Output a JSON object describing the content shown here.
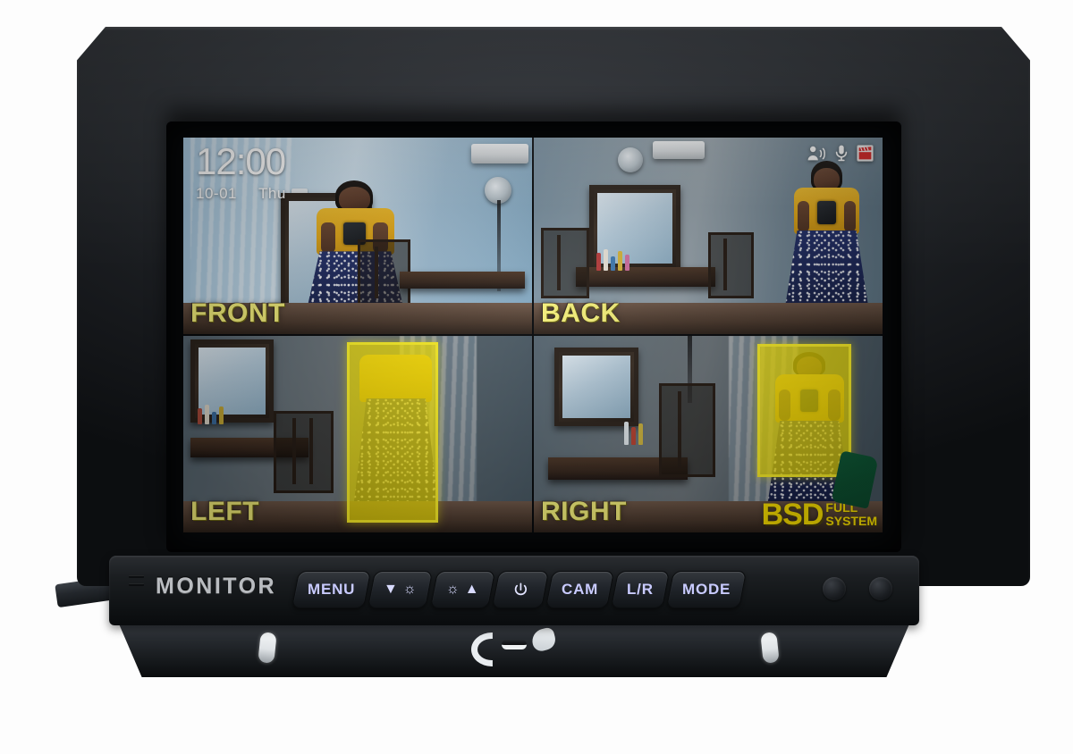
{
  "device": {
    "brand_label": "MONITOR",
    "type": "vehicle-blind-spot-detection-quad-monitor"
  },
  "osd": {
    "time": "12:00",
    "date": "10-01",
    "weekday": "Thu",
    "status_icons": [
      {
        "name": "voice-alert-icon",
        "title": "Voice alert"
      },
      {
        "name": "microphone-icon",
        "title": "Microphone"
      },
      {
        "name": "recording-icon",
        "title": "Recording"
      }
    ]
  },
  "quadrants": [
    {
      "id": "front",
      "label": "FRONT",
      "detection": false
    },
    {
      "id": "back",
      "label": "BACK",
      "detection": false
    },
    {
      "id": "left",
      "label": "LEFT",
      "detection": true
    },
    {
      "id": "right",
      "label": "RIGHT",
      "detection": true
    }
  ],
  "watermark": {
    "main": "BSD",
    "line1": "FULL",
    "line2": "SYSTEM"
  },
  "buttons": [
    {
      "id": "menu",
      "label": "MENU",
      "glyph": ""
    },
    {
      "id": "down-bright",
      "label": "",
      "glyph": "▼ ☼"
    },
    {
      "id": "up-bright",
      "label": "",
      "glyph": "☼ ▲"
    },
    {
      "id": "power",
      "label": "",
      "glyph": "⏻"
    },
    {
      "id": "cam",
      "label": "CAM",
      "glyph": ""
    },
    {
      "id": "lr",
      "label": "L/R",
      "glyph": ""
    },
    {
      "id": "mode",
      "label": "MODE",
      "glyph": ""
    }
  ],
  "colors": {
    "osd_label_yellow": "#f5f07a",
    "detection_yellow": "#ffec00",
    "logo_yellow": "#ffe400",
    "button_text": "#c9cbff",
    "bezel_black": "#141619"
  }
}
